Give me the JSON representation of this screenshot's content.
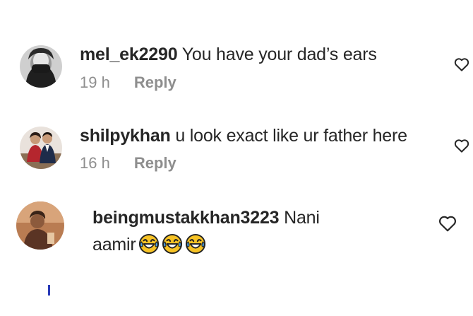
{
  "comments": [
    {
      "username": "mel_ek2290",
      "text": "You have your dad’s ears",
      "time": "19 h",
      "reply_label": "Reply"
    },
    {
      "username": "shilpykhan",
      "text": "u look exact like ur father here",
      "time": "16 h",
      "reply_label": "Reply"
    },
    {
      "username": "beingmustakkhan3223",
      "text_line1": "Nani",
      "text_line2": "aamir",
      "emojis": [
        "face-with-tears-of-joy",
        "face-with-tears-of-joy",
        "face-with-tears-of-joy"
      ]
    }
  ],
  "icons": {
    "like": "heart-outline-icon",
    "emoji": "face-with-tears-of-joy"
  },
  "colors": {
    "text": "#262626",
    "meta": "#8e8e8e",
    "emoji_face": "#f7c325",
    "emoji_tears": "#4aa3e8"
  }
}
